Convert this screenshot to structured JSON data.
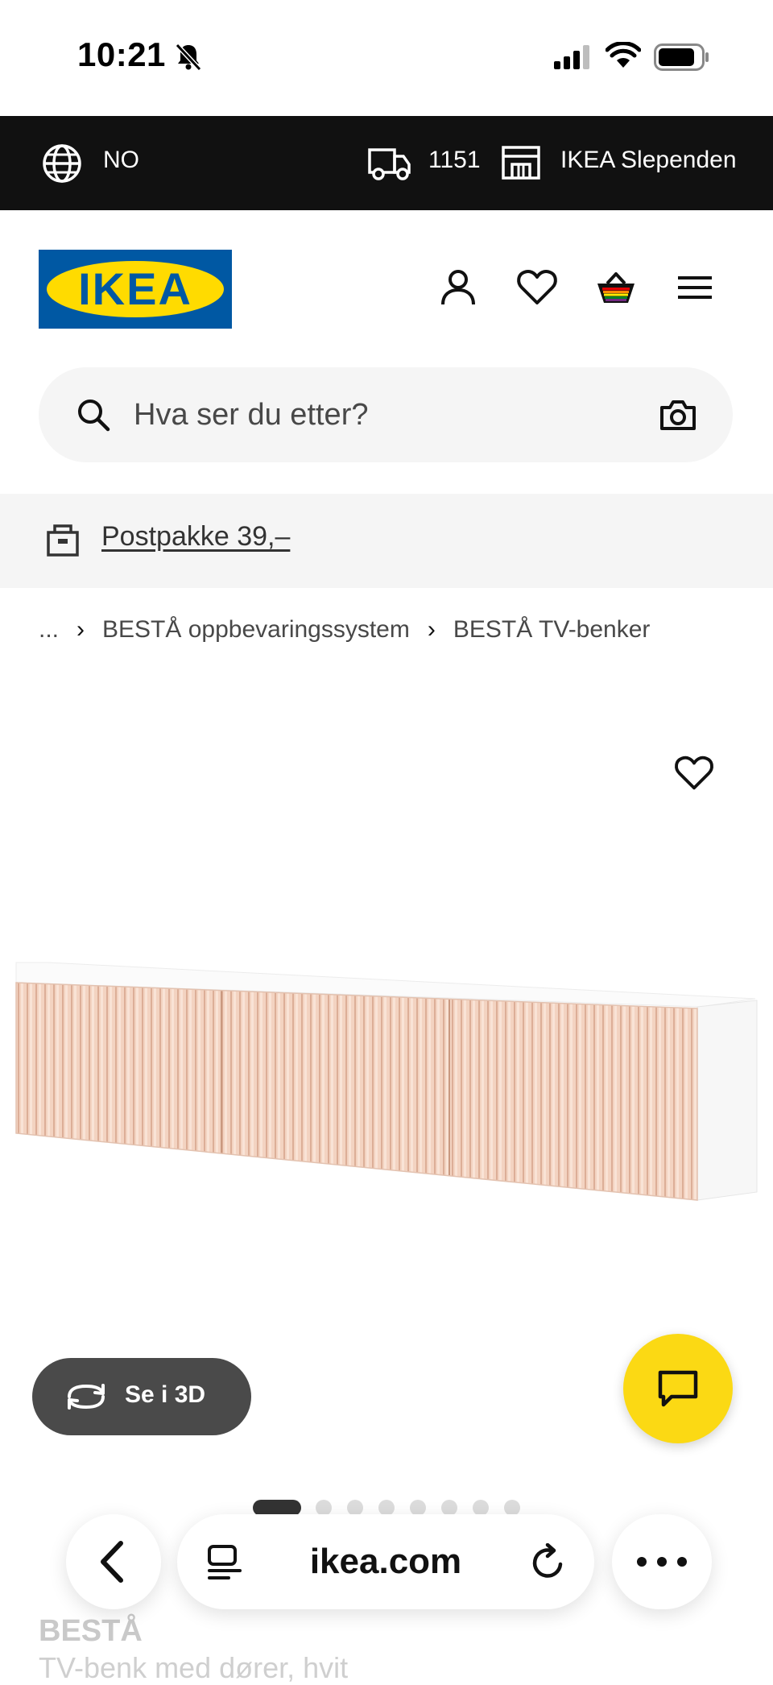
{
  "status_bar": {
    "time": "10:21"
  },
  "top_bar": {
    "language": "NO",
    "postcode": "1151",
    "store": "IKEA Slependen"
  },
  "header": {
    "logo_text": "IKEA"
  },
  "search": {
    "placeholder": "Hva ser du etter?"
  },
  "promo": {
    "text": "Postpakke 39,–"
  },
  "breadcrumb": {
    "ellipsis": "...",
    "items": [
      "BESTÅ oppbevaringssystem",
      "BESTÅ TV-benker"
    ]
  },
  "gallery": {
    "view_3d_label": "Se i 3D",
    "total_images": 8,
    "active_index": 1
  },
  "product": {
    "name": "BESTÅ",
    "description": "TV-benk med dører, hvit"
  },
  "browser": {
    "url": "ikea.com"
  },
  "colors": {
    "ikea_blue": "#0058a3",
    "ikea_yellow": "#ffdb00",
    "chat_yellow": "#fbd914"
  }
}
